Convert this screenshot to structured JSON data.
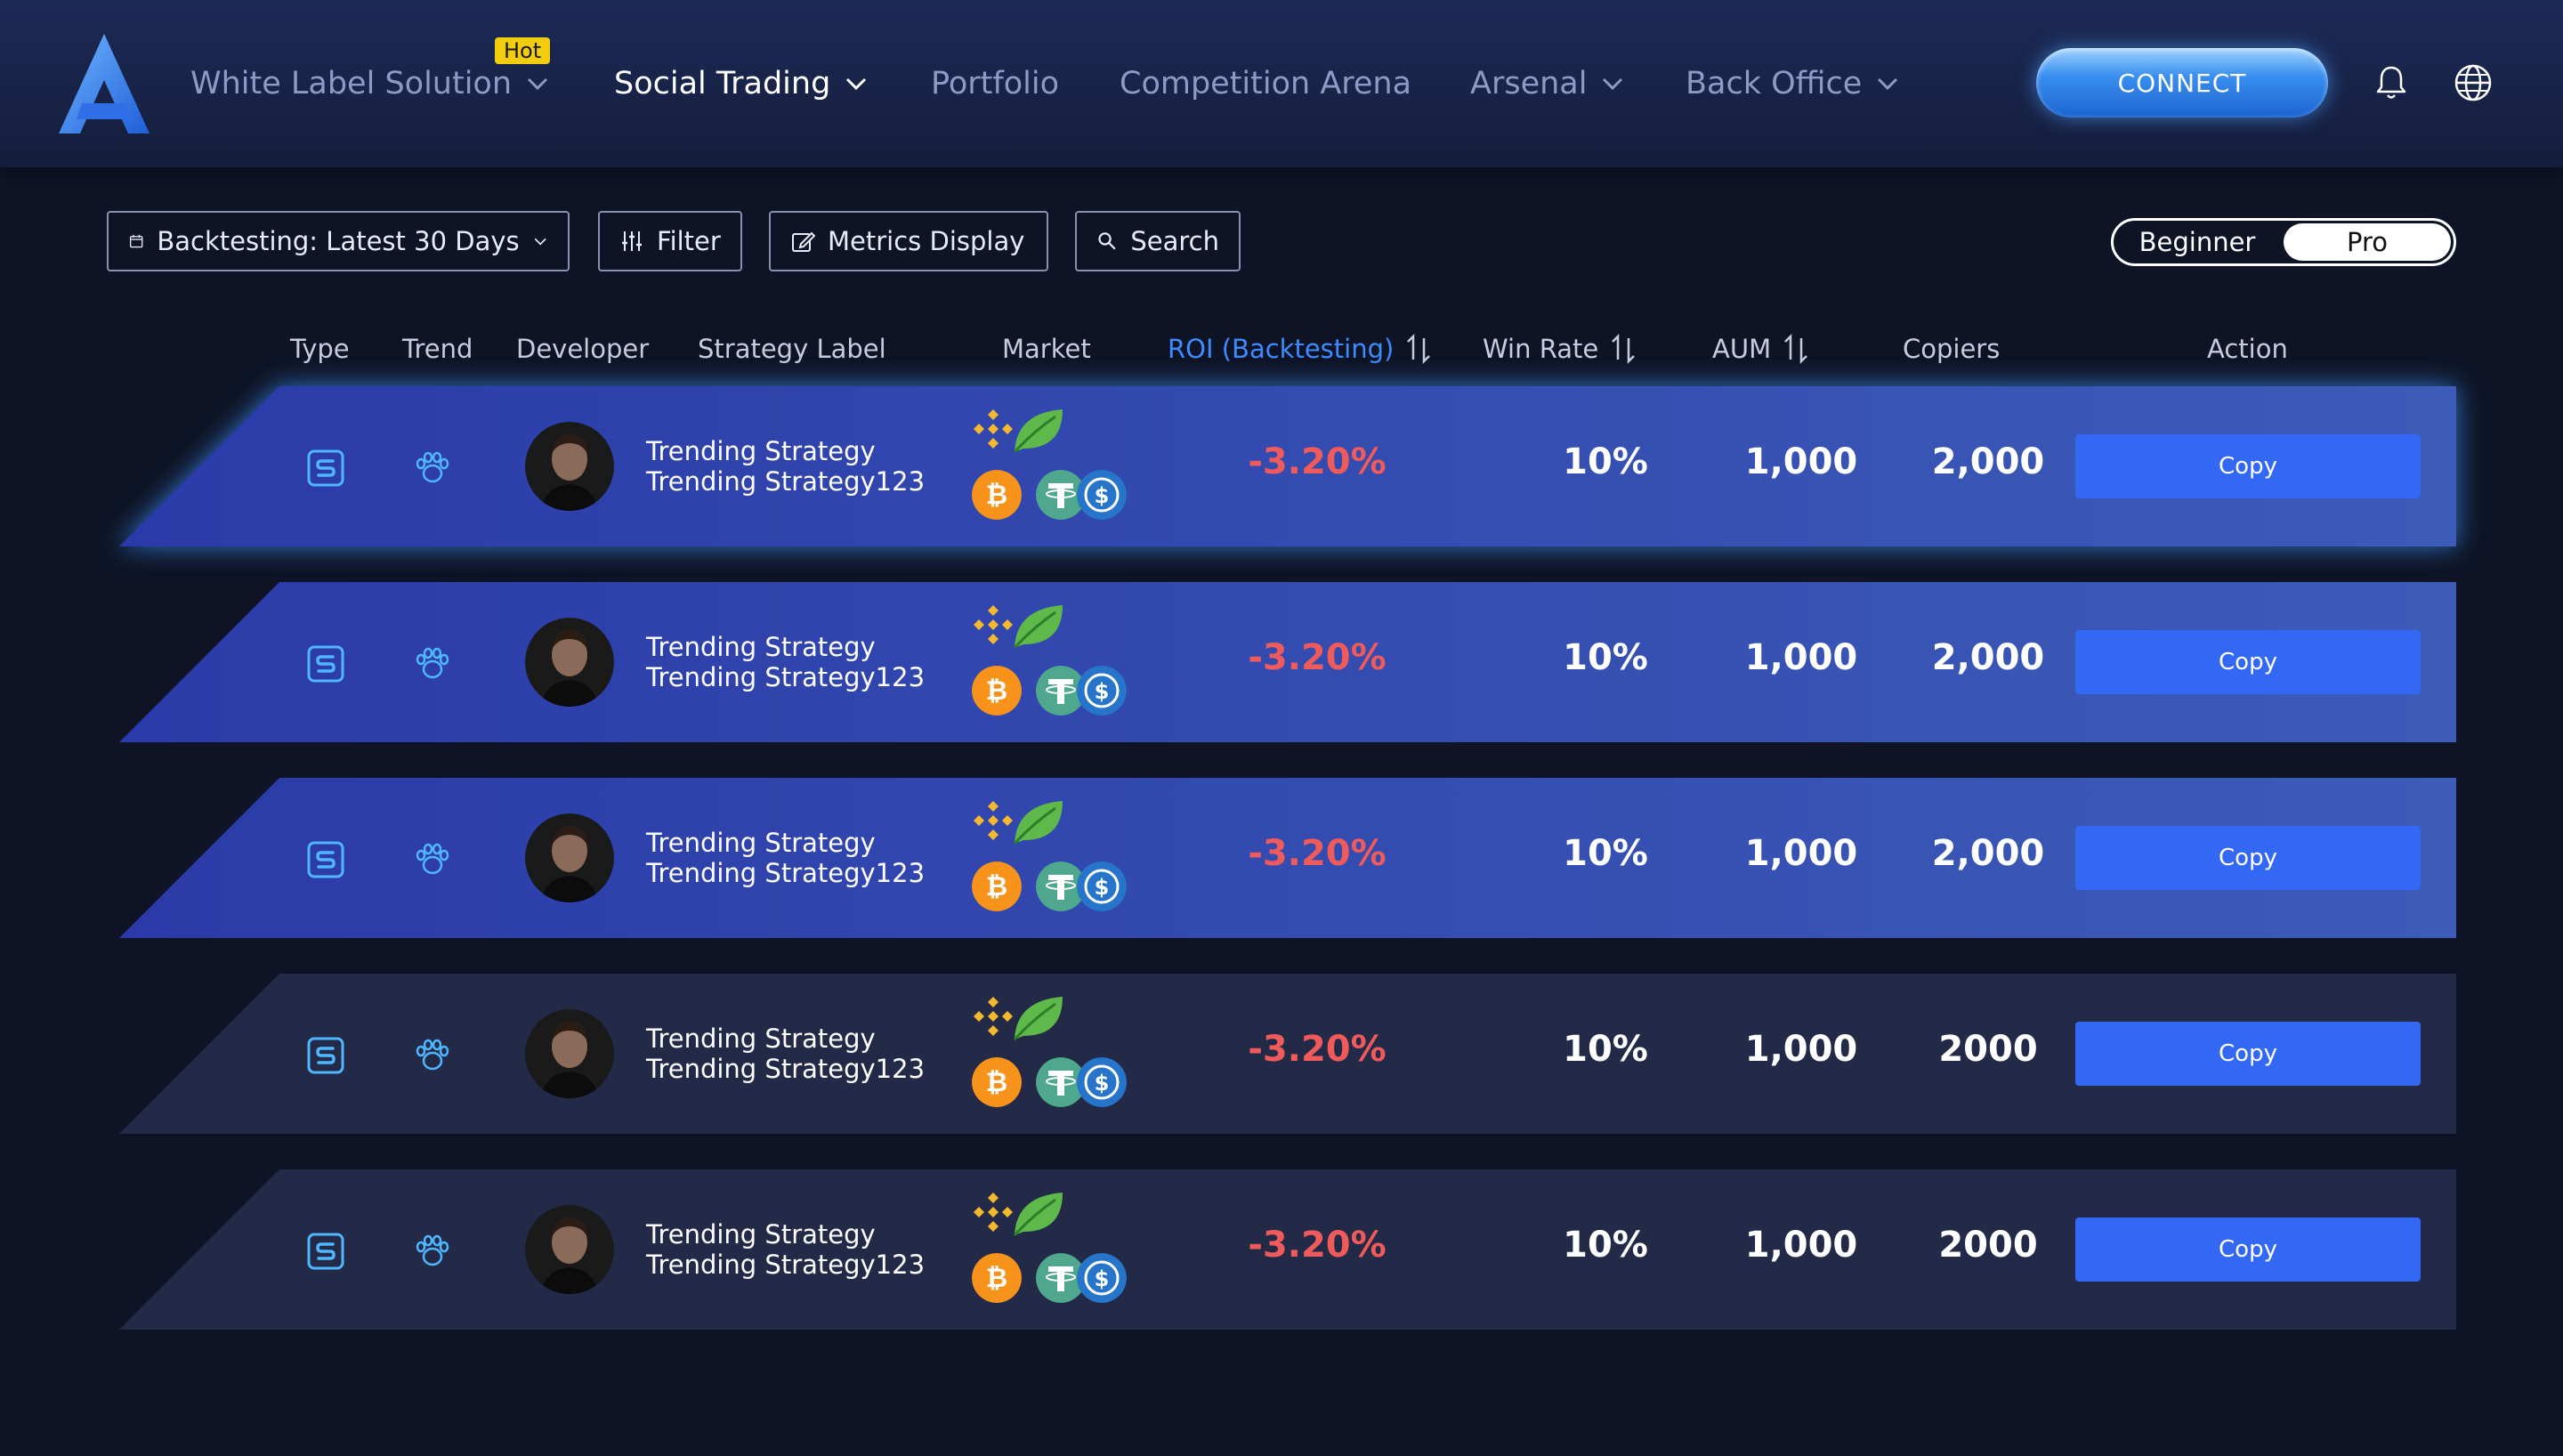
{
  "nav": {
    "items": [
      {
        "label": "White Label Solution",
        "badge": "Hot",
        "has_dropdown": true,
        "active": false
      },
      {
        "label": "Social Trading",
        "has_dropdown": true,
        "active": true
      },
      {
        "label": "Portfolio",
        "has_dropdown": false,
        "active": false
      },
      {
        "label": "Competition Arena",
        "has_dropdown": false,
        "active": false
      },
      {
        "label": "Arsenal",
        "has_dropdown": true,
        "active": false
      },
      {
        "label": "Back Office",
        "has_dropdown": true,
        "active": false
      }
    ],
    "connect_label": "CONNECT",
    "icons": [
      "bell-icon",
      "globe-icon"
    ]
  },
  "toolbar": {
    "period_label": "Backtesting: Latest 30 Days",
    "filter_label": "Filter",
    "metrics_label": "Metrics Display",
    "search_label": "Search",
    "mode_options": [
      "Beginner",
      "Pro"
    ],
    "mode_selected": "Pro"
  },
  "table": {
    "headers": [
      "Type",
      "Trend",
      "Developer",
      "Strategy Label",
      "Market",
      "ROI (Backtesting)",
      "Win Rate",
      "AUM",
      "Copiers",
      "Action"
    ],
    "rows": [
      {
        "name_line1": "Trending Strategy",
        "name_line2": "Trending Strategy123",
        "roi": "-3.20%",
        "win_rate": "10%",
        "aum": "1,000",
        "copiers": "2,000",
        "action": "Copy",
        "highlighted": true
      },
      {
        "name_line1": "Trending Strategy",
        "name_line2": "Trending Strategy123",
        "roi": "-3.20%",
        "win_rate": "10%",
        "aum": "1,000",
        "copiers": "2,000",
        "action": "Copy",
        "highlighted": false
      },
      {
        "name_line1": "Trending Strategy",
        "name_line2": "Trending Strategy123",
        "roi": "-3.20%",
        "win_rate": "10%",
        "aum": "1,000",
        "copiers": "2,000",
        "action": "Copy",
        "highlighted": false
      },
      {
        "name_line1": "Trending Strategy",
        "name_line2": "Trending Strategy123",
        "roi": "-3.20%",
        "win_rate": "10%",
        "aum": "1,000",
        "copiers": "2000",
        "action": "Copy",
        "highlighted": false
      },
      {
        "name_line1": "Trending Strategy",
        "name_line2": "Trending Strategy123",
        "roi": "-3.20%",
        "win_rate": "10%",
        "aum": "1,000",
        "copiers": "2000",
        "action": "Copy",
        "highlighted": false
      }
    ],
    "market_coins": [
      "binance-icon",
      "leaf-icon",
      "bitcoin-icon",
      "tether-icon",
      "usdc-icon"
    ]
  },
  "colors": {
    "accent": "#3d8bff",
    "roi_negative": "#ef5b5b",
    "copy_button": "#3368f5",
    "row_blue": "#3048a8",
    "row_dark": "#232a48"
  }
}
